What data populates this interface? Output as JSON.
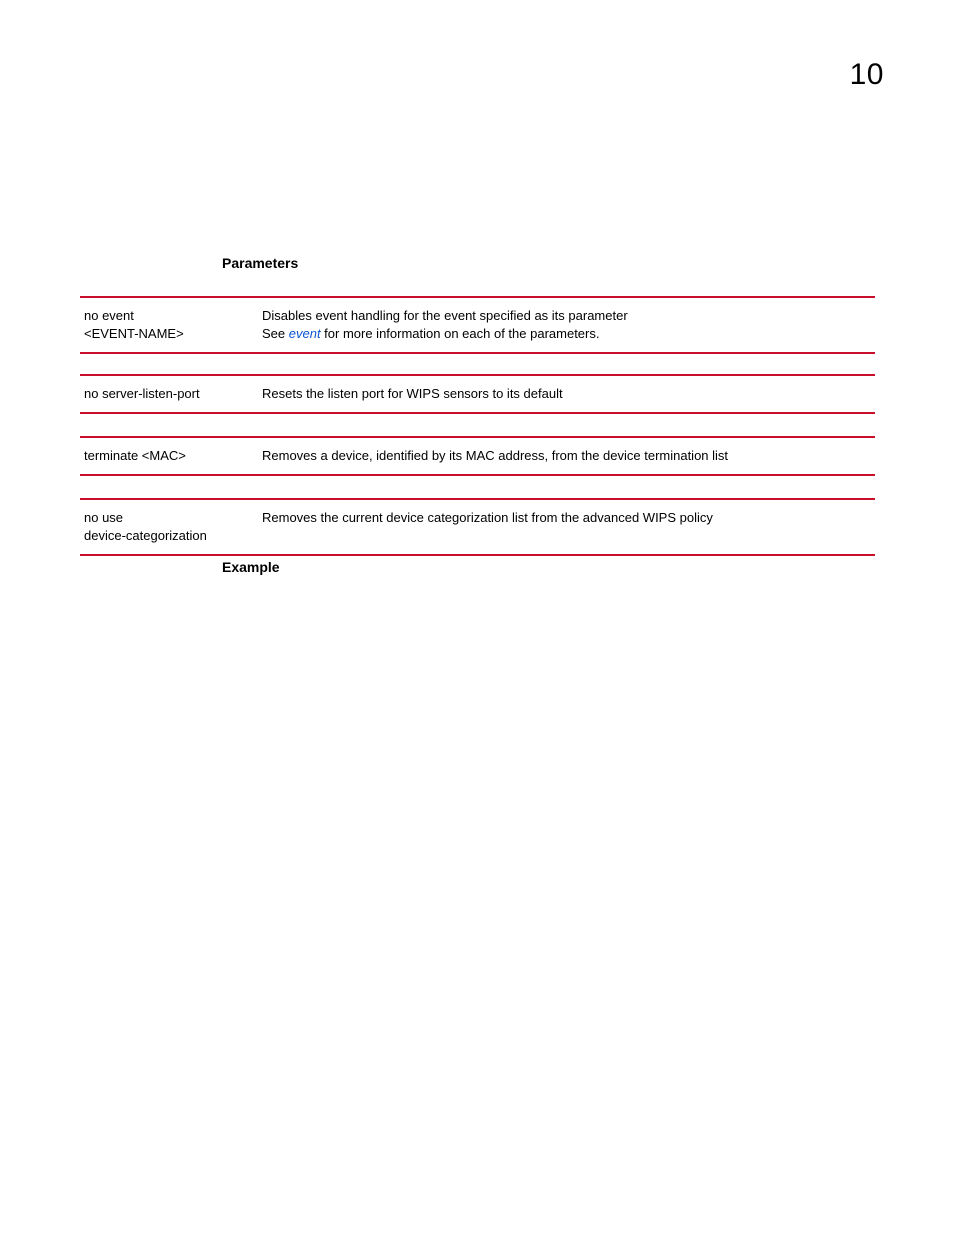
{
  "page_number": "10",
  "headings": {
    "parameters": "Parameters",
    "example": "Example"
  },
  "tables": [
    {
      "param": "no event <EVENT-NAME>",
      "desc_prefix": "Disables event handling for the event specified as its parameter\nSee ",
      "desc_link": "event",
      "desc_suffix": " for more information on each of the parameters."
    },
    {
      "param": "no server-listen-port",
      "desc": "Resets the listen port for WIPS sensors to its default"
    },
    {
      "param": "terminate <MAC>",
      "desc": "Removes a device, identified by its MAC address, from the device termination list"
    },
    {
      "param": "no use device-categorization",
      "desc": "Removes the current device categorization list from the advanced WIPS policy"
    }
  ]
}
